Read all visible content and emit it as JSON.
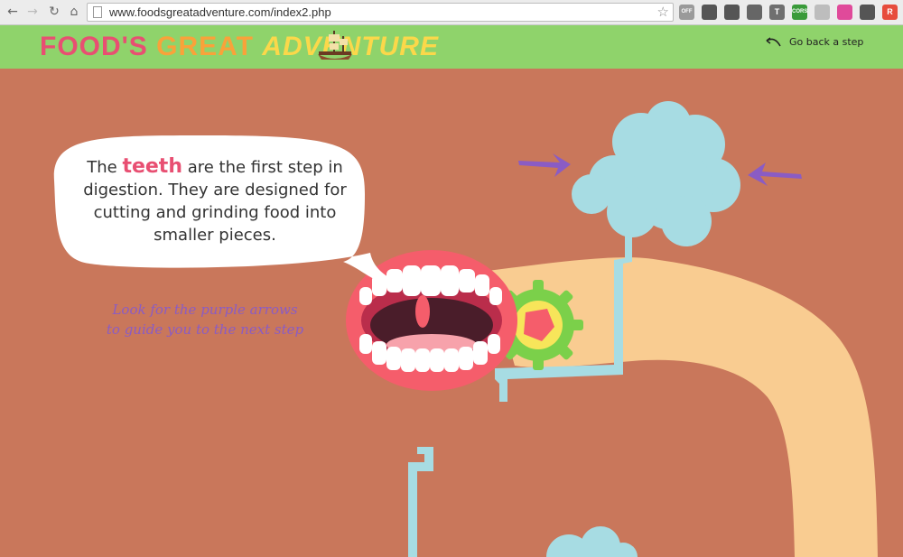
{
  "browser": {
    "url": "www.foodsgreatadventure.com/index2.php",
    "extensions": [
      {
        "name": "off-extension-icon",
        "label": "OFF",
        "color": "#9a9a9a"
      },
      {
        "name": "extension-icon-2",
        "label": "",
        "color": "#555555"
      },
      {
        "name": "pocket-icon",
        "label": "",
        "color": "#555555"
      },
      {
        "name": "extension-icon-4",
        "label": "",
        "color": "#666666"
      },
      {
        "name": "t-extension-icon",
        "label": "T",
        "color": "#6f6f6f"
      },
      {
        "name": "cors-extension-icon",
        "label": "CORS",
        "color": "#3a9b3a"
      },
      {
        "name": "extension-icon-7",
        "label": "",
        "color": "#bdbdbd"
      },
      {
        "name": "color-wheel-icon",
        "label": "",
        "color": "#e04a9a"
      },
      {
        "name": "move-icon",
        "label": "",
        "color": "#555555"
      },
      {
        "name": "r-extension-icon",
        "label": "R",
        "color": "#e74c3c"
      }
    ]
  },
  "header": {
    "logo": {
      "word1": "FOOD'S",
      "word2": "GREAT",
      "word3": "ADVENTURE"
    },
    "back_label": "Go back a step"
  },
  "speech": {
    "part1": "The",
    "highlight": "teeth",
    "part2": "are the first step in digestion. They are designed for cutting and grinding food into smaller pieces."
  },
  "hint": {
    "line1": "Look for the purple arrows",
    "line2": "to guide you to the next step"
  },
  "colors": {
    "background": "#c9775b",
    "header": "#8fd36b",
    "intestine": "#f9cc91",
    "liquid": "#a7dce3",
    "arrow": "#8a5cc4",
    "teeth_highlight": "#e84f72",
    "gums": "#f55d6b",
    "gear": "#7bd04a"
  }
}
